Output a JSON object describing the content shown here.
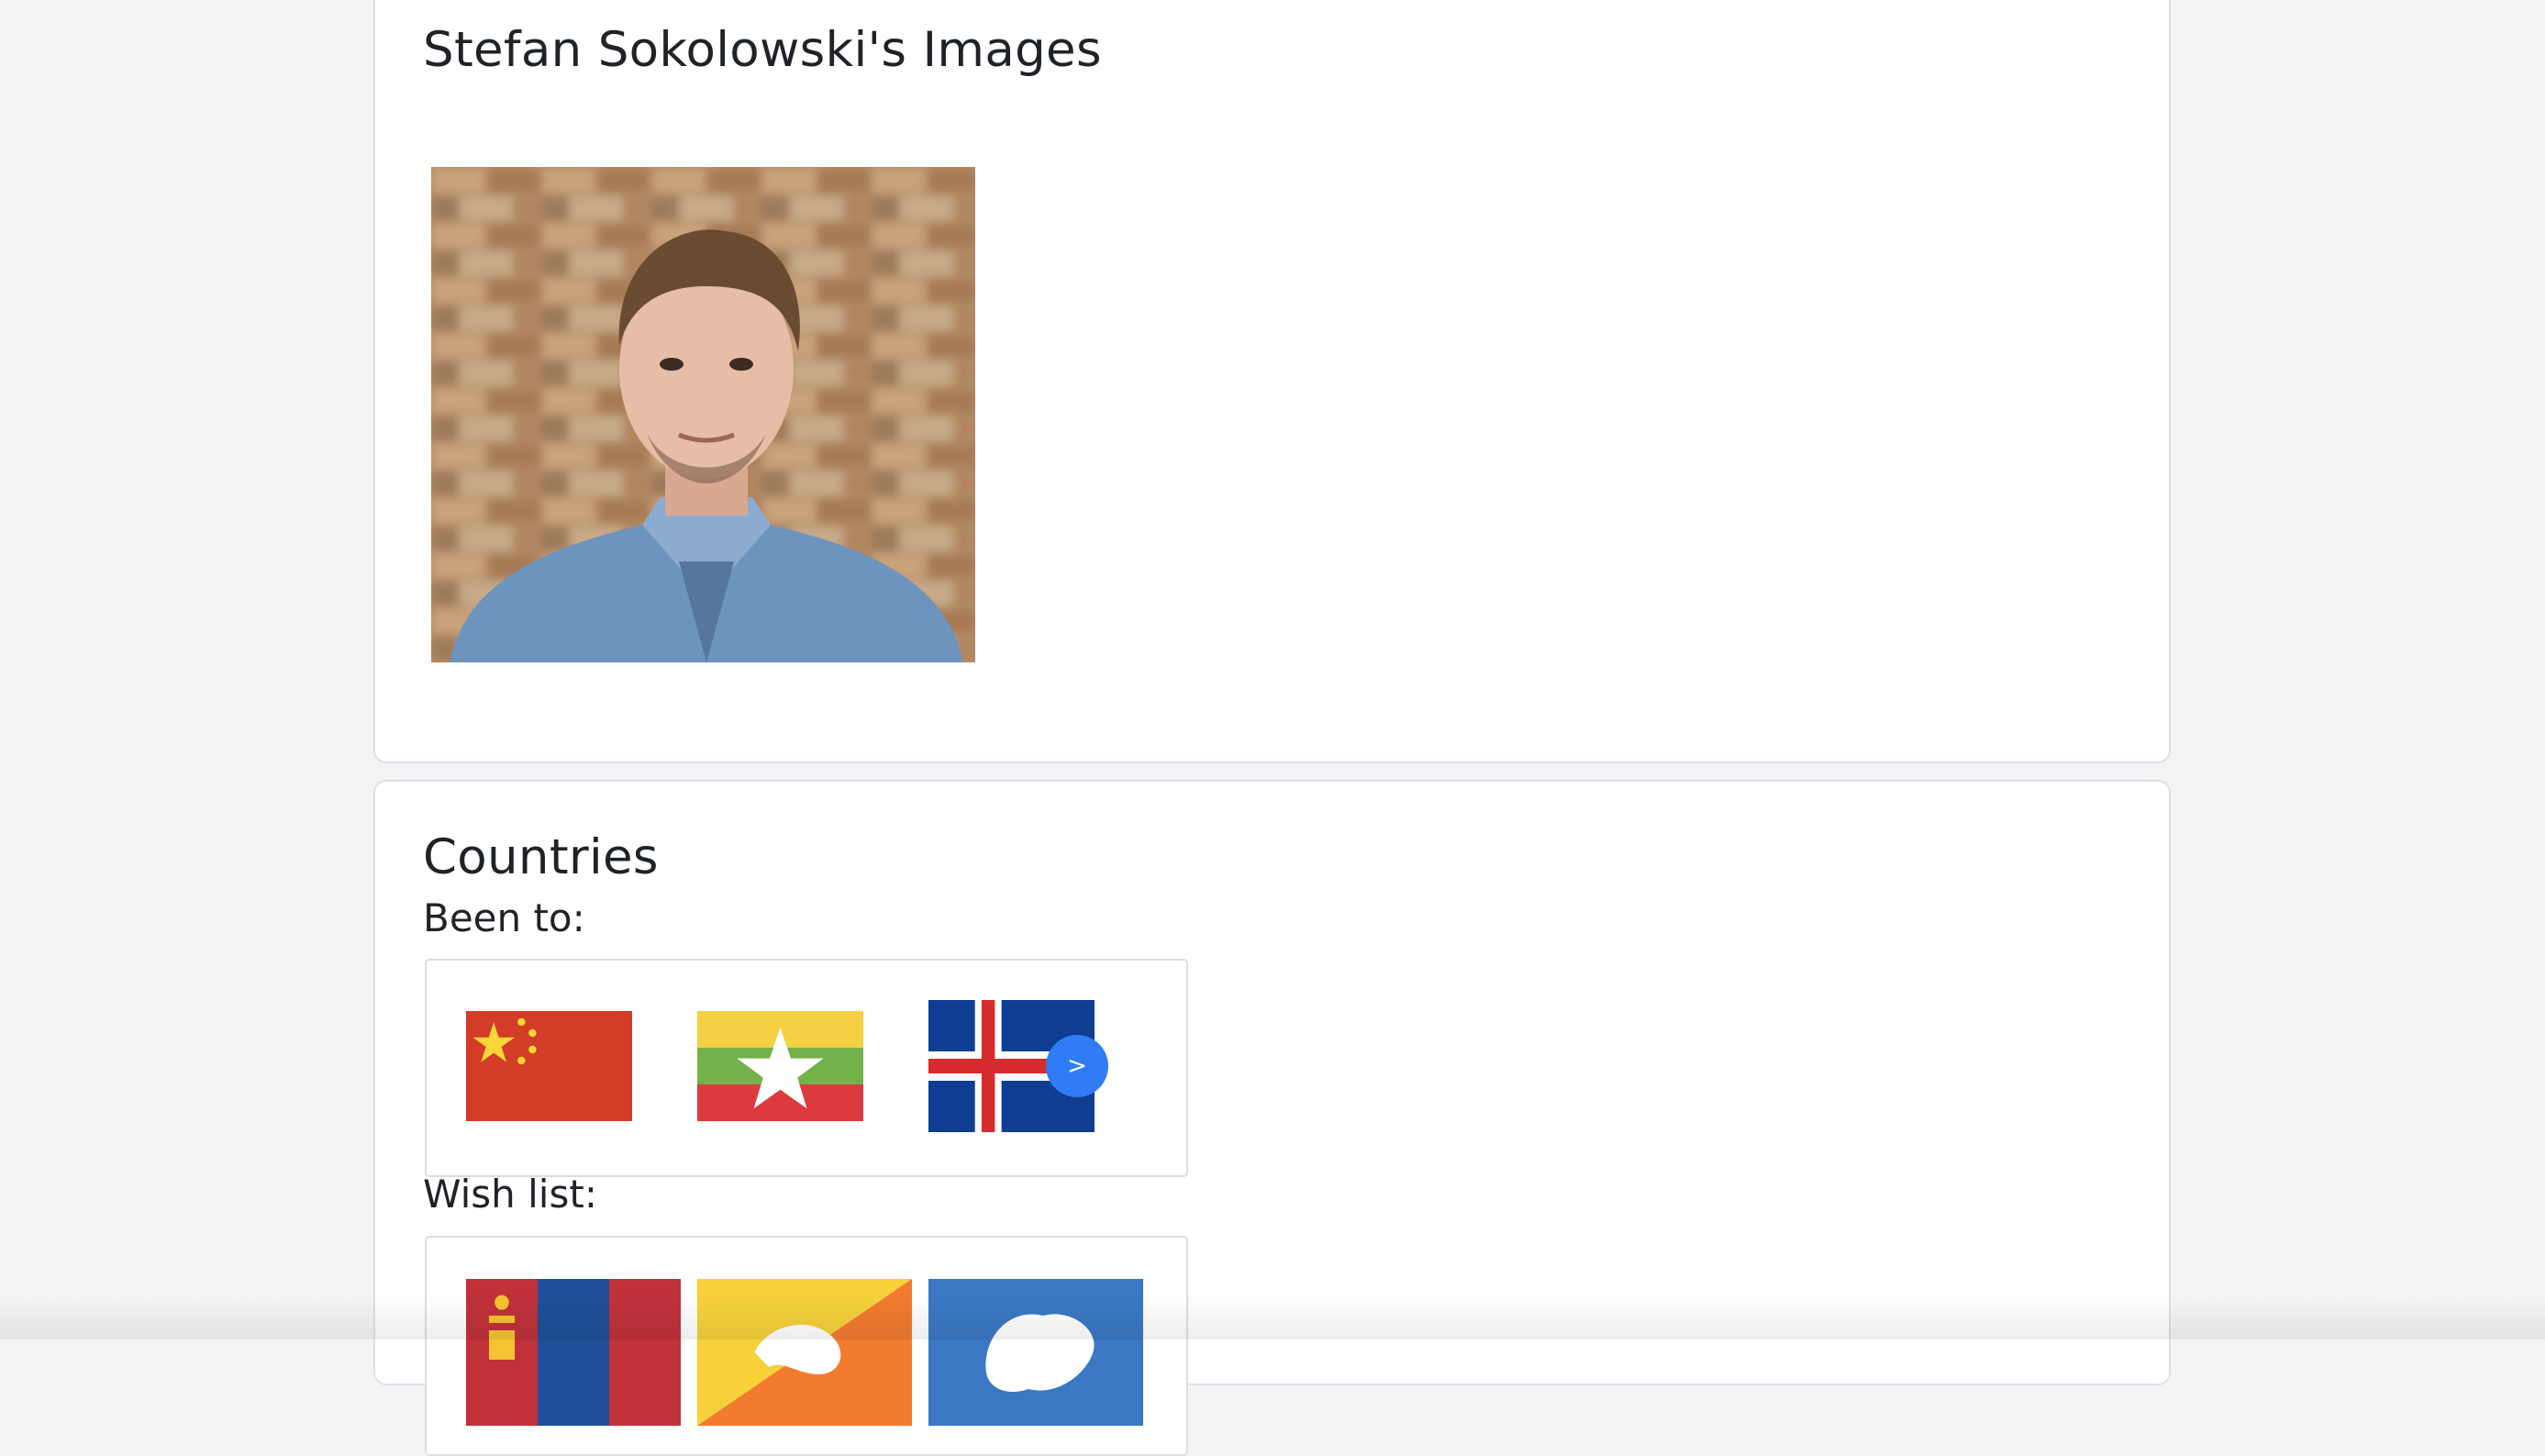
{
  "images_card": {
    "title": "Stefan Sokolowski's Images"
  },
  "countries_card": {
    "title": "Countries",
    "been_to": {
      "label": "Been to:",
      "flags": [
        "China",
        "Myanmar",
        "Iceland"
      ],
      "next_label": ">"
    },
    "wish_list": {
      "label": "Wish list:",
      "flags": [
        "Mongolia",
        "Bhutan",
        "Antarctica"
      ]
    }
  },
  "colors": {
    "page_background": "#f3f4f6",
    "card_background": "#ffffff",
    "accent_button": "#2f7cf6"
  }
}
